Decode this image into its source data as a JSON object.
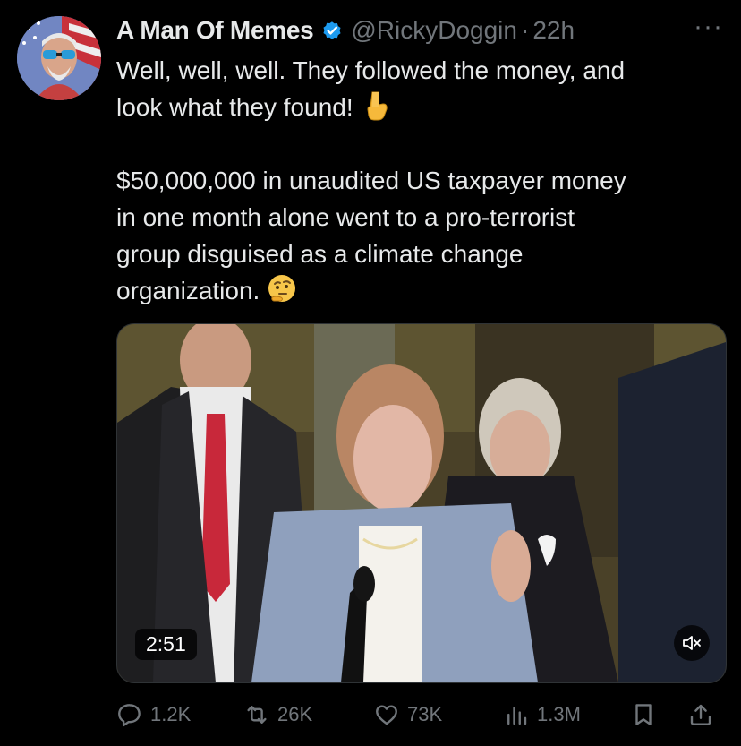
{
  "post": {
    "author_name": "A Man Of Memes",
    "handle": "@RickyDoggin",
    "separator": "·",
    "time_ago": "22h",
    "more_label": "···",
    "paragraphs": [
      "Well, well, well. They followed the money, and\nlook what they found!",
      "$50,000,000 in unaudited US taxpayer money\nin one month alone went to a pro-terrorist\ngroup disguised as a climate change\norganization."
    ],
    "emojis": [
      "pointing-down-emoji",
      "thinking-face-emoji"
    ]
  },
  "media": {
    "duration": "2:51",
    "muted": true
  },
  "actions": {
    "replies": "1.2K",
    "reposts": "26K",
    "likes": "73K",
    "views": "1.3M"
  },
  "colors": {
    "background": "#000000",
    "text_primary": "#e7e9ea",
    "text_secondary": "#71767b",
    "verified_badge": "#1d9bf0"
  }
}
